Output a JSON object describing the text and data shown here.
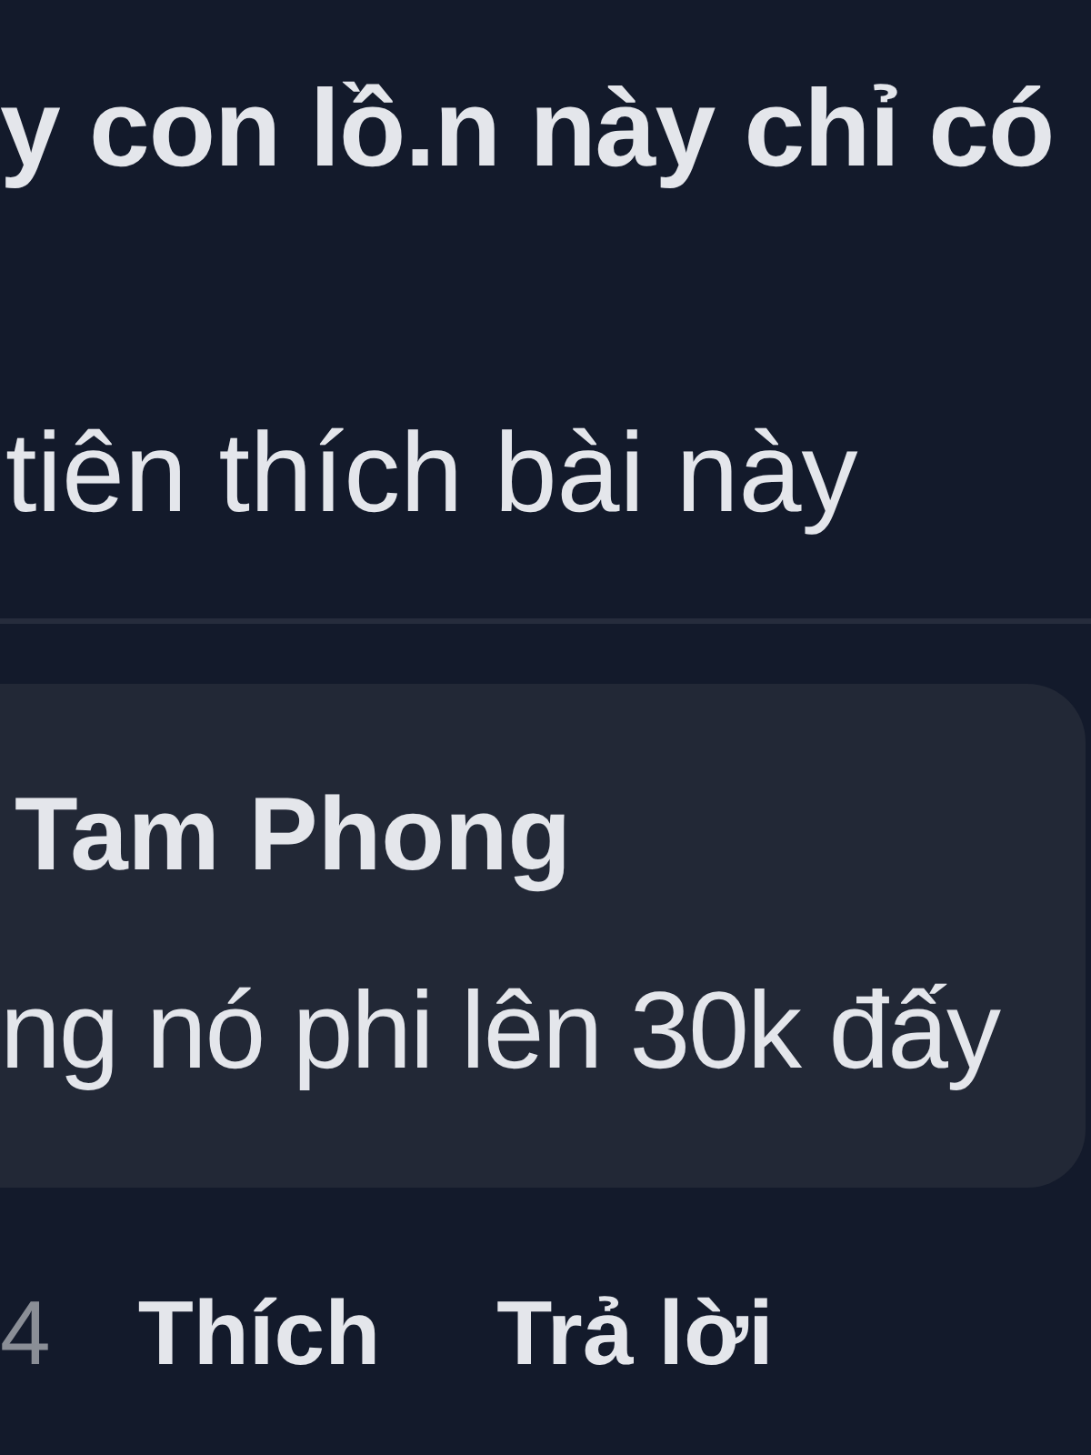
{
  "post": {
    "text": "y con lồ.n này chỉ có",
    "reactions_summary": "tiên thích bài này"
  },
  "comment": {
    "author": "Tam Phong",
    "text": "ng nó phi lên 30k đấy",
    "time": "4",
    "actions": [
      {
        "label": "Thích"
      },
      {
        "label": "Trả lời"
      }
    ]
  }
}
